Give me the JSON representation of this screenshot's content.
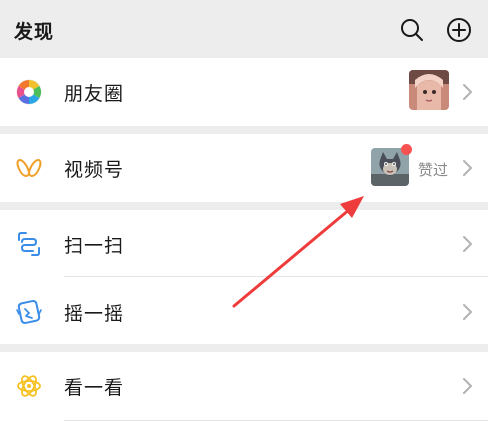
{
  "header": {
    "title": "发现",
    "search_icon": "search-icon",
    "add_icon": "plus-circle-icon"
  },
  "menu": {
    "moments": {
      "label": "朋友圈",
      "icon": "moments-aperture-icon",
      "thumb": "anime-girl-avatar"
    },
    "channels": {
      "label": "视频号",
      "icon": "channels-butterfly-icon",
      "thumb": "cat-avatar",
      "status": "赞过",
      "badge_color": "#fa5151"
    },
    "scan": {
      "label": "扫一扫",
      "icon": "scan-icon"
    },
    "shake": {
      "label": "摇一摇",
      "icon": "shake-icon"
    },
    "top_stories": {
      "label": "看一看",
      "icon": "top-stories-icon"
    }
  },
  "colors": {
    "background": "#ededed",
    "card": "#ffffff",
    "accent_blue": "#3b8ee8",
    "channels_orange": "#f0a029",
    "top_stories_yellow": "#f5c123",
    "annotation_arrow": "#ee3b3b"
  }
}
